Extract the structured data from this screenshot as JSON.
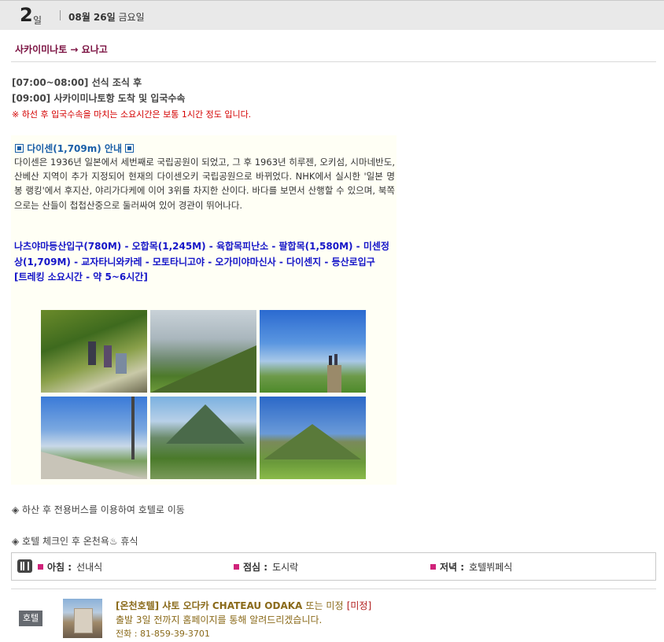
{
  "day": {
    "number": "2",
    "unit": "일",
    "date_bold": "08월 26일",
    "weekday": "금요일"
  },
  "route": "사카이미나토 → 요나고",
  "schedule": [
    "[07:00~08:00] 선식 조식 후",
    "[09:00] 사카이미나토항 도착 및 입국수속"
  ],
  "notice": "※ 하선 후 입국수속을 마치는 소요시간은 보통 1시간 정도 입니다.",
  "section": {
    "title": "다이센(1,709m) 안내",
    "description": "다이센은 1936년 일본에서 세번째로 국립공원이 되었고, 그 후 1963년 히루젠, 오키섬, 시마네반도, 산베산 지역이 추가 지정되어 현재의 다이센오키 국립공원으로 바뀌었다. NHK에서 실시한 '일본 명봉 랭킹'에서 후지산, 야리가다케에 이어 3위를 차지한 산이다. 바다를 보면서 산행할 수 있으며, 북쪽으로는 산들이 첩첩산중으로 둘러싸여 있어 경관이 뛰어나다.",
    "course": "나츠야마등산입구(780M) - 오합목(1,245M) - 육합목피난소 - 팔합목(1,580M) - 미센정상(1,709M) - 교자타니와카레 - 모토타니고야 - 오가미야마신사 - 다이센지 - 등산로입구",
    "trekking": "[트레킹 소요시간 - 약 5~6시간]"
  },
  "notes": [
    "◈ 하산 후 전용버스를 이용하여 호텔로 이동",
    "◈ 호텔 체크인 후 온천욕♨ 휴식"
  ],
  "meals": [
    {
      "label": "아침 :",
      "value": "선내식"
    },
    {
      "label": "점심 :",
      "value": "도시락"
    },
    {
      "label": "저녁 :",
      "value": "호텔뷔페식"
    }
  ],
  "hotel": {
    "badge": "호텔",
    "name_bold": "[온천호텔] 샤토 오다카 CHATEAU ODAKA",
    "name_plain": "또는 미정",
    "name_red": "[미정]",
    "note": "출발 3일 전까지 홈페이지를 통해 알려드리겠습니다.",
    "tel": "전화 : 81-859-39-3701"
  },
  "colors": {
    "route": "#7a1040",
    "section_title": "#1a5fa8",
    "course": "#1515c8",
    "notice": "#d40000",
    "hotel": "#8a6a1a"
  }
}
